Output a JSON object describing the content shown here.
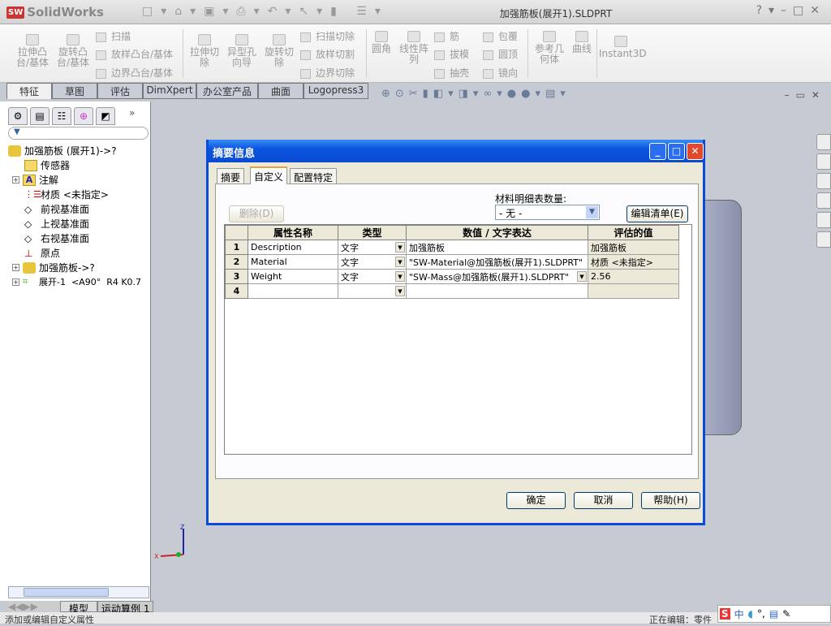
{
  "app": {
    "name": "SolidWorks",
    "logo_text": "SW",
    "document_title": "加强筋板(展开1).SLDPRT"
  },
  "ribbon": {
    "large": [
      {
        "label": "拉伸凸\n台/基体"
      },
      {
        "label": "旋转凸\n台/基体"
      },
      {
        "label": "拉伸切\n除"
      },
      {
        "label": "异型孔\n向导"
      },
      {
        "label": "旋转切\n除"
      },
      {
        "label": "圆角"
      },
      {
        "label": "线性阵\n列"
      },
      {
        "label": "参考几\n何体"
      },
      {
        "label": "曲线"
      },
      {
        "label": "Instant3D"
      }
    ],
    "small": [
      "扫描",
      "放样凸台/基体",
      "边界凸台/基体",
      "扫描切除",
      "放样切割",
      "边界切除",
      "筋",
      "拔模",
      "抽壳",
      "包覆",
      "圆顶",
      "镜向"
    ]
  },
  "command_tabs": [
    "特征",
    "草图",
    "评估",
    "DimXpert",
    "办公室产品",
    "曲面",
    "Logopress3"
  ],
  "feature_tree": {
    "items": [
      {
        "label": "加强筋板 (展开1)->?",
        "icon": "part-icon",
        "expand": false
      },
      {
        "label": "传感器",
        "icon": "sensor-folder-icon",
        "expand": false
      },
      {
        "label": "注解",
        "icon": "annotation-icon",
        "expand": true
      },
      {
        "label": "材质 <未指定>",
        "icon": "material-icon",
        "expand": false
      },
      {
        "label": "前视基准面",
        "icon": "plane-icon",
        "expand": false
      },
      {
        "label": "上视基准面",
        "icon": "plane-icon",
        "expand": false
      },
      {
        "label": "右视基准面",
        "icon": "plane-icon",
        "expand": false
      },
      {
        "label": "原点",
        "icon": "origin-icon",
        "expand": false
      },
      {
        "label": "加强筋板->?",
        "icon": "body-icon",
        "expand": true
      },
      {
        "label": "展开-1  <A90°  R4 K0.7",
        "icon": "flatten-icon",
        "expand": true
      }
    ]
  },
  "bottom_tabs": [
    "模型",
    "运动算例 1"
  ],
  "status": {
    "left": "添加或编辑自定义属性",
    "right": "正在编辑：零件"
  },
  "ime": {
    "label": "中",
    "extra": "°,"
  },
  "dialog": {
    "title": "摘要信息",
    "tabs": [
      "摘要",
      "自定义",
      "配置特定"
    ],
    "active_tab": "自定义",
    "delete_button": "删除(D)",
    "bom_label": "材料明细表数量:",
    "bom_value": "- 无 -",
    "edit_list_button": "编辑清单(E)",
    "columns": [
      "属性名称",
      "类型",
      "数值 / 文字表达",
      "评估的值"
    ],
    "rows": [
      {
        "n": "1",
        "name": "Description",
        "type": "文字",
        "value": "加强筋板",
        "eval": "加强筋板"
      },
      {
        "n": "2",
        "name": "Material",
        "type": "文字",
        "value": "\"SW-Material@加强筋板(展开1).SLDPRT\"",
        "eval": "材质 <未指定>"
      },
      {
        "n": "3",
        "name": "Weight",
        "type": "文字",
        "value": "\"SW-Mass@加强筋板(展开1).SLDPRT\"",
        "eval": "2.56"
      },
      {
        "n": "4",
        "name": "",
        "type": "",
        "value": "",
        "eval": ""
      }
    ],
    "ok": "确定",
    "cancel": "取消",
    "help": "帮助(H)"
  },
  "colors": {
    "dialog_title": "#0a55e0",
    "viewport": "#c6cbd3"
  }
}
